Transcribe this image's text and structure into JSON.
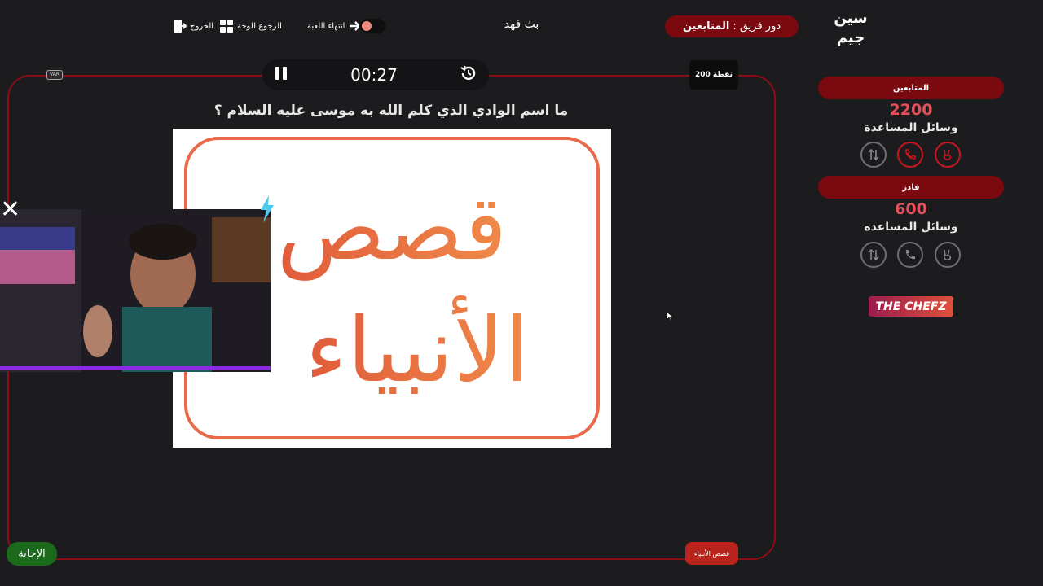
{
  "header": {
    "logo_text": "سين جيم",
    "turn_label": "دور فريق :",
    "turn_team": "المتابعين",
    "game_name": "بث فهد",
    "links": {
      "end_game": "انتهاء اللعبة",
      "back_to_board": "الرجوع للوحة",
      "exit": "الخروج"
    }
  },
  "question_panel": {
    "timer": "00:27",
    "var_label": "VAR",
    "points": "200 نقطة",
    "question": "ما اسم الوادي الذي كلم الله به موسى عليه السلام ؟",
    "image_text_line1": "قصص",
    "image_text_line2": "الأنبياء",
    "answer_button": "الإجابة",
    "category": "قصص الأنبياء"
  },
  "teams": [
    {
      "name": "المتابعين",
      "score": "2200",
      "helpers_label": "وسائل المساعدة",
      "helpers": [
        {
          "icon": "two-fingers-icon",
          "active": true
        },
        {
          "icon": "phone-icon",
          "active": true
        },
        {
          "icon": "swap-icon",
          "active": false
        }
      ]
    },
    {
      "name": "فادز",
      "score": "600",
      "helpers_label": "وسائل المساعدة",
      "helpers": [
        {
          "icon": "two-fingers-icon",
          "active": false
        },
        {
          "icon": "phone-icon",
          "active": false
        },
        {
          "icon": "swap-icon",
          "active": false
        }
      ]
    }
  ],
  "sponsor": "THE CHEFZ",
  "colors": {
    "background": "#1c1c1e",
    "accent_red": "#7a0a10",
    "score_red": "#e4505a",
    "answer_green": "#1b6a1b"
  }
}
